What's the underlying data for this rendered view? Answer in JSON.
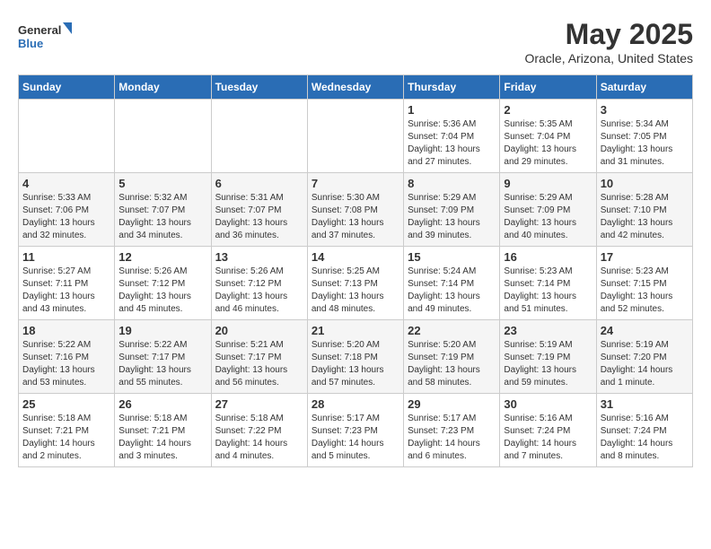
{
  "header": {
    "logo_line1": "General",
    "logo_line2": "Blue",
    "title": "May 2025",
    "subtitle": "Oracle, Arizona, United States"
  },
  "calendar": {
    "weekdays": [
      "Sunday",
      "Monday",
      "Tuesday",
      "Wednesday",
      "Thursday",
      "Friday",
      "Saturday"
    ],
    "weeks": [
      [
        {
          "day": "",
          "info": ""
        },
        {
          "day": "",
          "info": ""
        },
        {
          "day": "",
          "info": ""
        },
        {
          "day": "",
          "info": ""
        },
        {
          "day": "1",
          "info": "Sunrise: 5:36 AM\nSunset: 7:04 PM\nDaylight: 13 hours\nand 27 minutes."
        },
        {
          "day": "2",
          "info": "Sunrise: 5:35 AM\nSunset: 7:04 PM\nDaylight: 13 hours\nand 29 minutes."
        },
        {
          "day": "3",
          "info": "Sunrise: 5:34 AM\nSunset: 7:05 PM\nDaylight: 13 hours\nand 31 minutes."
        }
      ],
      [
        {
          "day": "4",
          "info": "Sunrise: 5:33 AM\nSunset: 7:06 PM\nDaylight: 13 hours\nand 32 minutes."
        },
        {
          "day": "5",
          "info": "Sunrise: 5:32 AM\nSunset: 7:07 PM\nDaylight: 13 hours\nand 34 minutes."
        },
        {
          "day": "6",
          "info": "Sunrise: 5:31 AM\nSunset: 7:07 PM\nDaylight: 13 hours\nand 36 minutes."
        },
        {
          "day": "7",
          "info": "Sunrise: 5:30 AM\nSunset: 7:08 PM\nDaylight: 13 hours\nand 37 minutes."
        },
        {
          "day": "8",
          "info": "Sunrise: 5:29 AM\nSunset: 7:09 PM\nDaylight: 13 hours\nand 39 minutes."
        },
        {
          "day": "9",
          "info": "Sunrise: 5:29 AM\nSunset: 7:09 PM\nDaylight: 13 hours\nand 40 minutes."
        },
        {
          "day": "10",
          "info": "Sunrise: 5:28 AM\nSunset: 7:10 PM\nDaylight: 13 hours\nand 42 minutes."
        }
      ],
      [
        {
          "day": "11",
          "info": "Sunrise: 5:27 AM\nSunset: 7:11 PM\nDaylight: 13 hours\nand 43 minutes."
        },
        {
          "day": "12",
          "info": "Sunrise: 5:26 AM\nSunset: 7:12 PM\nDaylight: 13 hours\nand 45 minutes."
        },
        {
          "day": "13",
          "info": "Sunrise: 5:26 AM\nSunset: 7:12 PM\nDaylight: 13 hours\nand 46 minutes."
        },
        {
          "day": "14",
          "info": "Sunrise: 5:25 AM\nSunset: 7:13 PM\nDaylight: 13 hours\nand 48 minutes."
        },
        {
          "day": "15",
          "info": "Sunrise: 5:24 AM\nSunset: 7:14 PM\nDaylight: 13 hours\nand 49 minutes."
        },
        {
          "day": "16",
          "info": "Sunrise: 5:23 AM\nSunset: 7:14 PM\nDaylight: 13 hours\nand 51 minutes."
        },
        {
          "day": "17",
          "info": "Sunrise: 5:23 AM\nSunset: 7:15 PM\nDaylight: 13 hours\nand 52 minutes."
        }
      ],
      [
        {
          "day": "18",
          "info": "Sunrise: 5:22 AM\nSunset: 7:16 PM\nDaylight: 13 hours\nand 53 minutes."
        },
        {
          "day": "19",
          "info": "Sunrise: 5:22 AM\nSunset: 7:17 PM\nDaylight: 13 hours\nand 55 minutes."
        },
        {
          "day": "20",
          "info": "Sunrise: 5:21 AM\nSunset: 7:17 PM\nDaylight: 13 hours\nand 56 minutes."
        },
        {
          "day": "21",
          "info": "Sunrise: 5:20 AM\nSunset: 7:18 PM\nDaylight: 13 hours\nand 57 minutes."
        },
        {
          "day": "22",
          "info": "Sunrise: 5:20 AM\nSunset: 7:19 PM\nDaylight: 13 hours\nand 58 minutes."
        },
        {
          "day": "23",
          "info": "Sunrise: 5:19 AM\nSunset: 7:19 PM\nDaylight: 13 hours\nand 59 minutes."
        },
        {
          "day": "24",
          "info": "Sunrise: 5:19 AM\nSunset: 7:20 PM\nDaylight: 14 hours\nand 1 minute."
        }
      ],
      [
        {
          "day": "25",
          "info": "Sunrise: 5:18 AM\nSunset: 7:21 PM\nDaylight: 14 hours\nand 2 minutes."
        },
        {
          "day": "26",
          "info": "Sunrise: 5:18 AM\nSunset: 7:21 PM\nDaylight: 14 hours\nand 3 minutes."
        },
        {
          "day": "27",
          "info": "Sunrise: 5:18 AM\nSunset: 7:22 PM\nDaylight: 14 hours\nand 4 minutes."
        },
        {
          "day": "28",
          "info": "Sunrise: 5:17 AM\nSunset: 7:23 PM\nDaylight: 14 hours\nand 5 minutes."
        },
        {
          "day": "29",
          "info": "Sunrise: 5:17 AM\nSunset: 7:23 PM\nDaylight: 14 hours\nand 6 minutes."
        },
        {
          "day": "30",
          "info": "Sunrise: 5:16 AM\nSunset: 7:24 PM\nDaylight: 14 hours\nand 7 minutes."
        },
        {
          "day": "31",
          "info": "Sunrise: 5:16 AM\nSunset: 7:24 PM\nDaylight: 14 hours\nand 8 minutes."
        }
      ]
    ]
  }
}
